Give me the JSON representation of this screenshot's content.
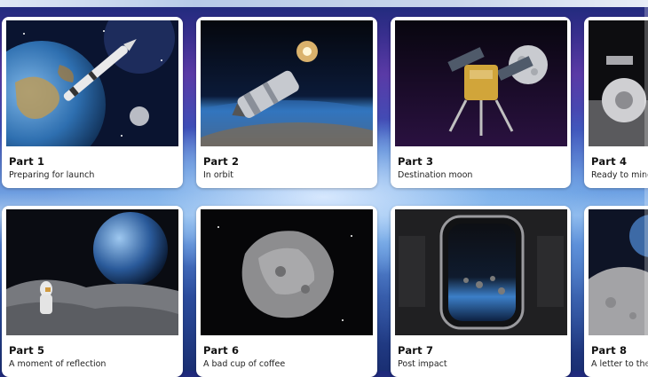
{
  "parts": [
    {
      "title": "Part 1",
      "subtitle": "Preparing for launch",
      "image": "rocket-earth-image"
    },
    {
      "title": "Part 2",
      "subtitle": "In orbit",
      "image": "orbit-capsule-image"
    },
    {
      "title": "Part 3",
      "subtitle": "Destination moon",
      "image": "lander-moon-image"
    },
    {
      "title": "Part 4",
      "subtitle": "Ready to mine",
      "image": "mining-drill-image"
    },
    {
      "title": "Part 5",
      "subtitle": "A moment of reflection",
      "image": "astronaut-earthrise-image"
    },
    {
      "title": "Part 6",
      "subtitle": "A bad cup of coffee",
      "image": "asteroid-image"
    },
    {
      "title": "Part 7",
      "subtitle": "Post impact",
      "image": "window-debris-image"
    },
    {
      "title": "Part 8",
      "subtitle": "A letter to the",
      "image": "moon-surface-image"
    }
  ]
}
